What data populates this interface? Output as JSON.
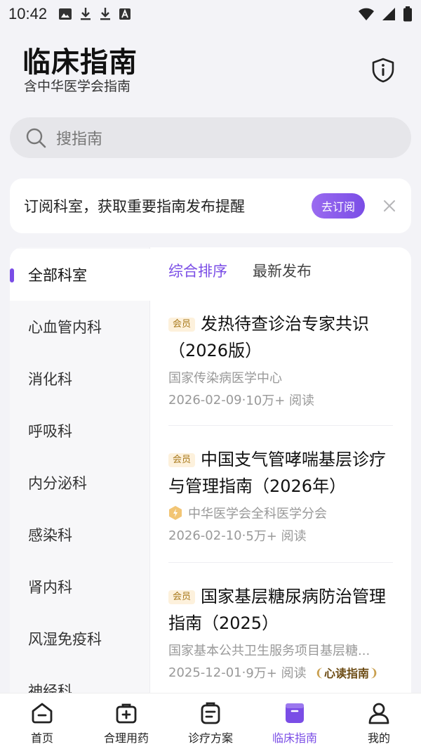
{
  "status_bar": {
    "time": "10:42"
  },
  "header": {
    "title": "临床指南",
    "subtitle": "含中华医学会指南"
  },
  "search": {
    "placeholder": "搜指南"
  },
  "subscription": {
    "text": "订阅科室，获取重要指南发布提醒",
    "button_label": "去订阅"
  },
  "departments": [
    {
      "label": "全部科室",
      "active": true
    },
    {
      "label": "心血管内科"
    },
    {
      "label": "消化科"
    },
    {
      "label": "呼吸科"
    },
    {
      "label": "内分泌科"
    },
    {
      "label": "感染科"
    },
    {
      "label": "肾内科"
    },
    {
      "label": "风湿免疫科"
    },
    {
      "label": "神经科"
    }
  ],
  "sort_tabs": [
    {
      "label": "综合排序",
      "active": true
    },
    {
      "label": "最新发布"
    }
  ],
  "guides": [
    {
      "badge": "会员",
      "title": "发热待查诊治专家共识（2026版）",
      "source": "国家传染病医学中心",
      "date": "2026-02-09",
      "reads": "10万+ 阅读"
    },
    {
      "badge": "会员",
      "title": "中国支气管哮喘基层诊疗与管理指南（2026年）",
      "source": "中华医学会全科医学分会",
      "date": "2026-02-10",
      "reads": "5万+ 阅读"
    },
    {
      "badge": "会员",
      "title": "国家基层糖尿病防治管理指南（2025）",
      "source": "国家基本公共卫生服务项目基层糖...",
      "date": "2025-12-01",
      "reads": "9万+ 阅读",
      "tag": "心读指南"
    }
  ],
  "meta_separator": " · ",
  "tab_bar": [
    {
      "label": "首页",
      "icon": "home-icon"
    },
    {
      "label": "合理用药",
      "icon": "medicine-kit-icon"
    },
    {
      "label": "诊疗方案",
      "icon": "clipboard-icon"
    },
    {
      "label": "临床指南",
      "icon": "guide-book-icon",
      "active": true
    },
    {
      "label": "我的",
      "icon": "profile-icon"
    }
  ],
  "colors": {
    "accent": "#7a4de6",
    "background": "#f3f3f7",
    "badge_bg": "#fdf1dc",
    "badge_text": "#a8791c"
  }
}
